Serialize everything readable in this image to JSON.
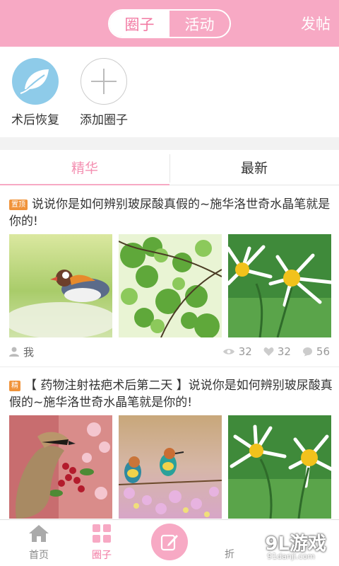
{
  "header": {
    "tabs": [
      {
        "label": "圈子",
        "active": true
      },
      {
        "label": "活动",
        "active": false
      }
    ],
    "post_label": "发帖",
    "colors": {
      "brand": "#f7a9c4",
      "accent": "#f27aa3"
    }
  },
  "circles": [
    {
      "label": "术后恢复",
      "icon": "leaf-icon"
    },
    {
      "label": "添加圈子",
      "icon": "plus-icon"
    }
  ],
  "feed_tabs": [
    {
      "label": "精华",
      "active": true
    },
    {
      "label": "最新",
      "active": false
    }
  ],
  "posts": [
    {
      "badge": "置顶",
      "title": "说说你是如何辨别玻尿酸真假的~施华洛世奇水晶笔就是你的!",
      "images": [
        "mandarin-duck-photo",
        "green-maple-leaves-photo",
        "white-daisy-photo"
      ],
      "author": "我",
      "views": "32",
      "likes": "32",
      "comments": "56"
    },
    {
      "badge": "精",
      "title": "【 药物注射祛疤术后第二天 】说说你是如何辨别玻尿酸真假的~施华洛世奇水晶笔就是你的!",
      "images": [
        "waxwing-bird-blossom-photo",
        "bee-eater-birds-photo",
        "white-daisy-photo"
      ]
    }
  ],
  "bottom_nav": [
    {
      "label": "首页",
      "icon": "home-icon",
      "active": false
    },
    {
      "label": "圈子",
      "icon": "grid-icon",
      "active": true
    },
    {
      "label": "",
      "icon": "compose-icon",
      "active": false
    },
    {
      "label": "折",
      "icon": "discount-icon",
      "active": false
    }
  ],
  "watermark": {
    "main": "9L游戏",
    "sub": "91danji.com"
  }
}
